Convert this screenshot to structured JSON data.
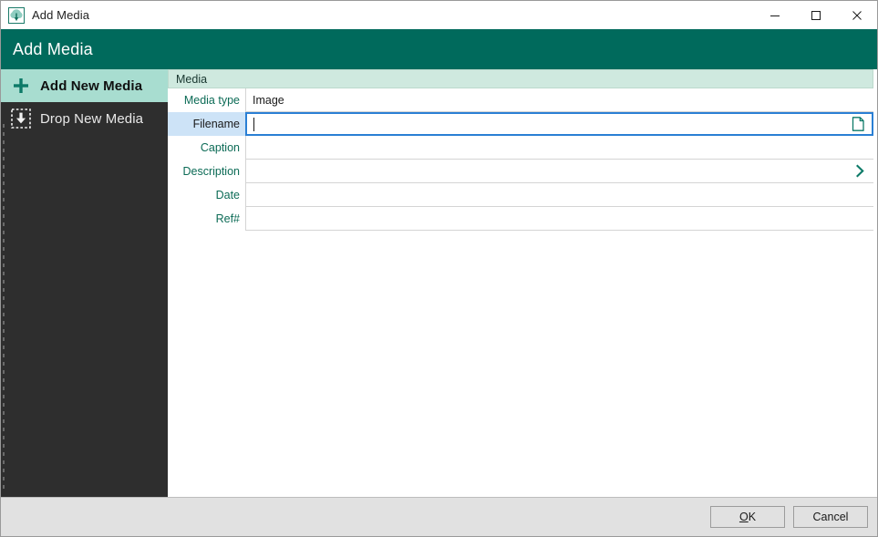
{
  "window": {
    "title": "Add Media",
    "app_icon": "tree-icon",
    "controls": {
      "minimize": "minimize-icon",
      "maximize": "maximize-icon",
      "close": "close-icon"
    }
  },
  "header": {
    "title": "Add Media",
    "background": "#006a5c",
    "text_color": "#ffffff"
  },
  "sidebar": {
    "background": "#2e2e2e",
    "selected_background": "#a8ddd0",
    "items": [
      {
        "label": "Add New Media",
        "icon": "plus-icon",
        "selected": true
      },
      {
        "label": "Drop New Media",
        "icon": "drop-target-download-icon",
        "selected": false
      }
    ]
  },
  "content": {
    "tab": {
      "label": "Media",
      "active": true,
      "background": "#cfe9df"
    },
    "label_color": "#0c6b56",
    "active_row_label_background": "#cde3f7",
    "focus_border_color": "#2a7fd4",
    "fields": [
      {
        "label": "Media type",
        "value": "Image",
        "icon": null,
        "active": false,
        "readonly": true
      },
      {
        "label": "Filename",
        "value": "",
        "icon": "file-page-icon",
        "active": true,
        "readonly": false
      },
      {
        "label": "Caption",
        "value": "",
        "icon": null,
        "active": false,
        "readonly": false
      },
      {
        "label": "Description",
        "value": "",
        "icon": "chevron-right-icon",
        "active": false,
        "readonly": false
      },
      {
        "label": "Date",
        "value": "",
        "icon": null,
        "active": false,
        "readonly": false
      },
      {
        "label": "Ref#",
        "value": "",
        "icon": null,
        "active": false,
        "readonly": false
      }
    ]
  },
  "footer": {
    "background": "#e1e1e1",
    "buttons": [
      {
        "label": "OK",
        "accel": "O",
        "name": "ok-button"
      },
      {
        "label": "Cancel",
        "accel": "",
        "name": "cancel-button"
      }
    ]
  }
}
